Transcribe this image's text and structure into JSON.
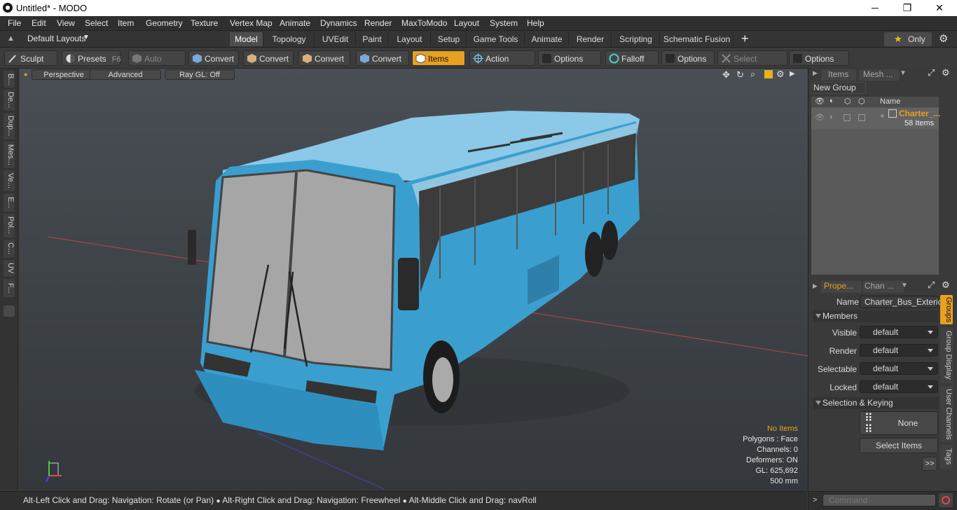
{
  "window": {
    "title": "Untitled* - MODO",
    "minimize": "─",
    "maximize": "❐",
    "close": "✕"
  },
  "menu": [
    "File",
    "Edit",
    "View",
    "Select",
    "Item",
    "Geometry",
    "Texture",
    "Vertex Map",
    "Animate",
    "Dynamics",
    "Render",
    "MaxToModo",
    "Layout",
    "System",
    "Help"
  ],
  "layouts": {
    "selector": "Default Layouts",
    "tabs": [
      "Model",
      "Topology",
      "UVEdit",
      "Paint",
      "Layout",
      "Setup",
      "Game Tools",
      "Animate",
      "Render",
      "Scripting",
      "Schematic Fusion"
    ],
    "active": "Model",
    "add": "+",
    "only_label": "Only"
  },
  "toolbar": {
    "sculpt": "Sculpt",
    "presets": "Presets",
    "presets_key": "F6",
    "auto_select": "Auto Select",
    "convert1": "Convert",
    "convert2": "Convert",
    "convert3": "Convert",
    "convert4": "Convert",
    "items": "Items",
    "action_center": "Action Center",
    "options1": "Options",
    "falloff": "Falloff",
    "options2": "Options",
    "select_through": "Select Through",
    "options3": "Options"
  },
  "left_tabs": [
    "B...",
    "De...",
    "Dup...",
    "Mes...",
    "Ve...",
    "E...",
    "Pol...",
    "C...",
    "UV",
    "F..."
  ],
  "viewport": {
    "perspective": "Perspective",
    "advanced": "Advanced",
    "raygl": "Ray GL: Off"
  },
  "stats": {
    "no_items": "No Items",
    "polygons": "Polygons : Face",
    "channels": "Channels: 0",
    "deformers": "Deformers: ON",
    "gl": "GL: 625,692",
    "scale": "500 mm"
  },
  "status": {
    "hint1": "Alt-Left Click and Drag: Navigation: Rotate (or Pan)",
    "hint2": "Alt-Right Click and Drag: Navigation: Freewheel",
    "hint3": "Alt-Middle Click and Drag: navRoll"
  },
  "items_panel": {
    "tab_items": "Items",
    "tab_mesh": "Mesh ...",
    "new_group": "New Group",
    "col_name": "Name",
    "group_name": "Charter_...",
    "group_count": "58 Items"
  },
  "props_panel": {
    "tab_props": "Prope...",
    "tab_chan": "Chan ...",
    "name_label": "Name",
    "name_value": "Charter_Bus_Exterio",
    "members": "Members",
    "visible_label": "Visible",
    "visible_value": "default",
    "render_label": "Render",
    "render_value": "default",
    "selectable_label": "Selectable",
    "selectable_value": "default",
    "locked_label": "Locked",
    "locked_value": "default",
    "sel_keying": "Selection & Keying",
    "none_label": "None",
    "select_items": "Select Items",
    "more": ">>"
  },
  "side_tabs": [
    "Groups",
    "Group Display",
    "User Channels",
    "Tags"
  ],
  "command": {
    "placeholder": "Command"
  },
  "colors": {
    "accent": "#e8a020",
    "bus_blue": "#3a9fcf"
  }
}
